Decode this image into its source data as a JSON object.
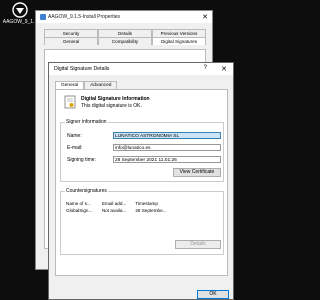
{
  "desktop": {
    "icon_label": "AAGOW_9_1..."
  },
  "props": {
    "title": "AAGOW_9.1.5-Install Properties",
    "tabs_row1": [
      "Security",
      "Details",
      "Previous Versions"
    ],
    "tabs_row2": [
      "General",
      "Compatibility",
      "Digital Signatures"
    ]
  },
  "dialog": {
    "title": "Digital Signature Details",
    "help": "?",
    "close": "X",
    "tabs": [
      "General",
      "Advanced"
    ],
    "info_heading": "Digital Signature Information",
    "info_text": "This digital signature is OK.",
    "signer": {
      "label": "Signer information",
      "name_label": "Name:",
      "name_value": "LUNATICO ASTRONOMIA SL",
      "email_label": "E-mail:",
      "email_value": "info@lunatico.es",
      "time_label": "Signing time:",
      "time_value": "28 September 2021 11:01:26",
      "view_cert": "View Certificate"
    },
    "counter": {
      "label": "Countersignatures",
      "headers": [
        "Name of s...",
        "Email add...",
        "Timestamp"
      ],
      "rows": [
        [
          "GlobalSign...",
          "Not availa...",
          "28 Septembe..."
        ]
      ],
      "details": "Details"
    },
    "ok": "OK"
  }
}
